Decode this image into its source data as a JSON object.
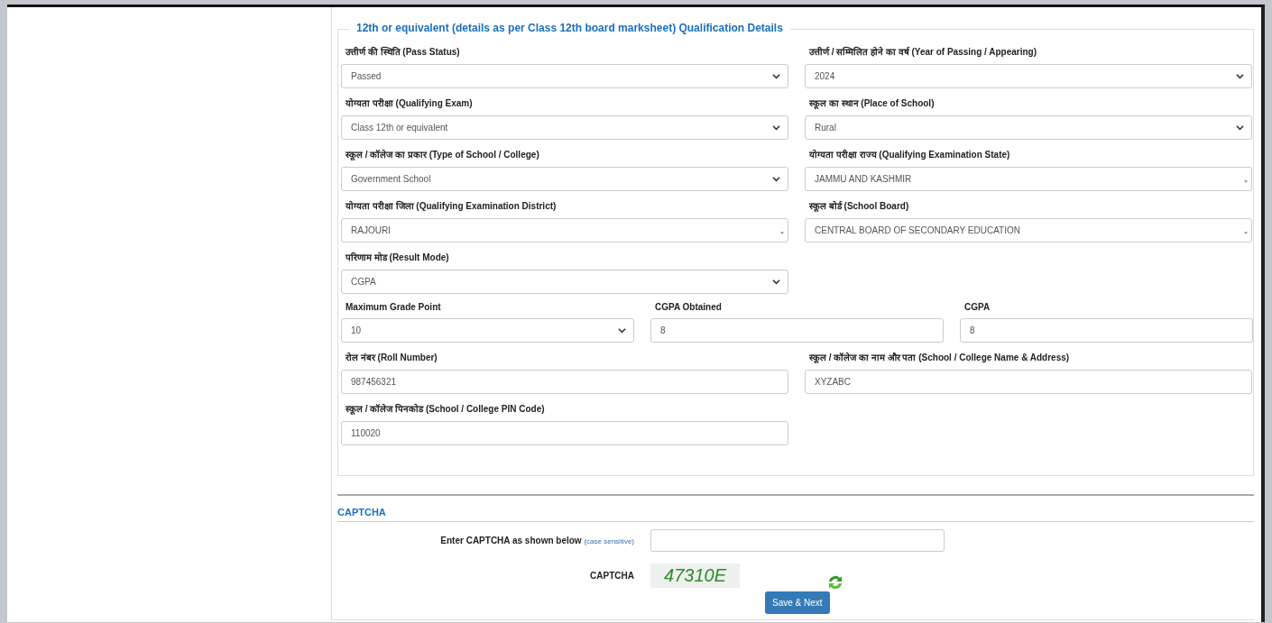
{
  "section": {
    "legend": "12th or equivalent (details as per Class 12th board marksheet) Qualification Details",
    "rows": [
      {
        "fields": [
          {
            "label": "उत्तीर्ण की स्थिति (Pass Status)",
            "kind": "select",
            "value": "Passed"
          },
          {
            "label": "उत्तीर्ण / सम्मिलित होने का वर्ष (Year of Passing / Appearing)",
            "kind": "select",
            "value": "2024"
          }
        ]
      },
      {
        "fields": [
          {
            "label": "योग्यता परीक्षा (Qualifying Exam)",
            "kind": "select",
            "value": "Class 12th or equivalent"
          },
          {
            "label": "स्कूल का स्थान (Place of School)",
            "kind": "select",
            "value": "Rural"
          }
        ]
      },
      {
        "fields": [
          {
            "label": "स्कूल / कॉलेज का प्रकार (Type of School / College)",
            "kind": "select",
            "value": "Government School"
          },
          {
            "label": "योग्यता परीक्षा राज्य (Qualifying Examination State)",
            "kind": "combo",
            "value": "JAMMU AND KASHMIR"
          }
        ]
      },
      {
        "fields": [
          {
            "label": "योग्यता परीक्षा जिला (Qualifying Examination District)",
            "kind": "combo",
            "value": "RAJOURI"
          },
          {
            "label": "स्कूल बोर्ड (School Board)",
            "kind": "combo",
            "value": "CENTRAL BOARD OF SECONDARY EDUCATION"
          }
        ]
      },
      {
        "fields": [
          {
            "label": "परिणाम मोड (Result Mode)",
            "kind": "select",
            "value": "CGPA"
          }
        ]
      },
      {
        "fields": [
          {
            "label": "Maximum Grade Point",
            "kind": "select",
            "value": "10"
          },
          {
            "label": "CGPA Obtained",
            "kind": "input",
            "value": "8"
          },
          {
            "label": "CGPA",
            "kind": "input",
            "value": "8"
          }
        ]
      },
      {
        "fields": [
          {
            "label": "रोल नंबर (Roll Number)",
            "kind": "input",
            "value": "987456321"
          },
          {
            "label": "स्कूल / कॉलेज का नाम और पता (School / College Name & Address)",
            "kind": "input",
            "value": "XYZABC"
          }
        ]
      },
      {
        "fields": [
          {
            "label": "स्कूल / कॉलेज पिनकोड (School / College PIN Code)",
            "kind": "input",
            "value": "110020"
          }
        ]
      }
    ]
  },
  "captcha": {
    "heading": "CAPTCHA",
    "prompt": "Enter CAPTCHA as shown below",
    "hint": "(case sensitive)",
    "image_label": "CAPTCHA",
    "image_text": "47310E"
  },
  "button": "Save & Next"
}
